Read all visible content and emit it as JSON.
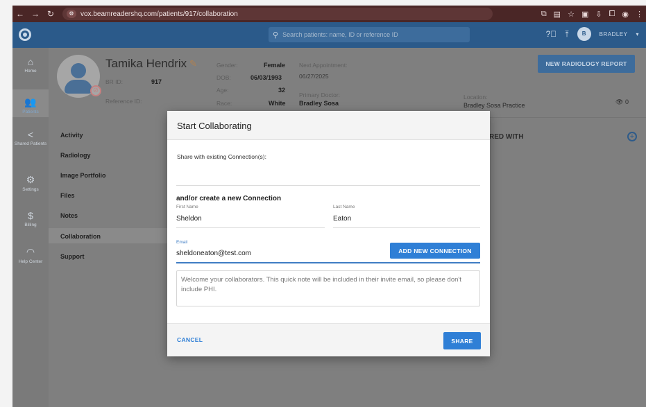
{
  "browser": {
    "url": "vox.beamreadershq.com/patients/917/collaboration",
    "nav_icons": [
      "back-arrow-icon",
      "forward-arrow-icon",
      "reload-icon"
    ],
    "right_icons": [
      "cast-icon",
      "tab-icon",
      "star-icon",
      "extension-icon",
      "mic-icon",
      "puzzle-icon",
      "profile-icon",
      "menu-icon"
    ]
  },
  "header": {
    "search_placeholder": "Search patients: name, ID or reference ID",
    "user_initial": "B",
    "user_name": "BRADLEY",
    "user_caret": "▾"
  },
  "rail": {
    "items": [
      {
        "label": "Home",
        "icon": "home-icon"
      },
      {
        "label": "Patients",
        "icon": "patients-icon",
        "active": true
      },
      {
        "label": "Shared Patients",
        "icon": "share-icon"
      },
      {
        "label": "Settings",
        "icon": "gear-icon"
      },
      {
        "label": "Billing",
        "icon": "dollar-icon"
      },
      {
        "label": "Help Center",
        "icon": "help-icon"
      }
    ]
  },
  "patient": {
    "name": "Tamika Hendrix",
    "br_id_label": "BR ID:",
    "br_id": "917",
    "reference_label": "Reference ID:",
    "gender_label": "Gender:",
    "gender": "Female",
    "dob_label": "DOB:",
    "dob": "06/03/1993",
    "age_label": "Age:",
    "age": "32",
    "race_label": "Race:",
    "race": "White",
    "next_appt_label": "Next Appointment:",
    "next_appt": "06/27/2025",
    "doctor_label": "Primary Doctor:",
    "doctor": "Bradley Sosa",
    "location_label": "Location:",
    "location": "Bradley Sosa Practice",
    "views": "0",
    "report_button": "NEW RADIOLOGY REPORT"
  },
  "subnav": {
    "items": [
      "Activity",
      "Radiology",
      "Image Portfolio",
      "Files",
      "Notes",
      "Collaboration",
      "Support"
    ],
    "active": "Collaboration"
  },
  "shared_with": "RED WITH",
  "modal": {
    "title": "Start Collaborating",
    "existing_label": "Share with existing Connection(s):",
    "new_section_title": "and/or create a new Connection",
    "first_name_label": "First Name",
    "first_name": "Sheldon",
    "last_name_label": "Last Name",
    "last_name": "Eaton",
    "email_label": "Email",
    "email": "sheldoneaton@test.com",
    "add_button": "ADD NEW CONNECTION",
    "note_placeholder": "Welcome your collaborators. This quick note will be included in their invite email, so please don't include PHI.",
    "cancel_button": "CANCEL",
    "share_button": "SHARE"
  }
}
